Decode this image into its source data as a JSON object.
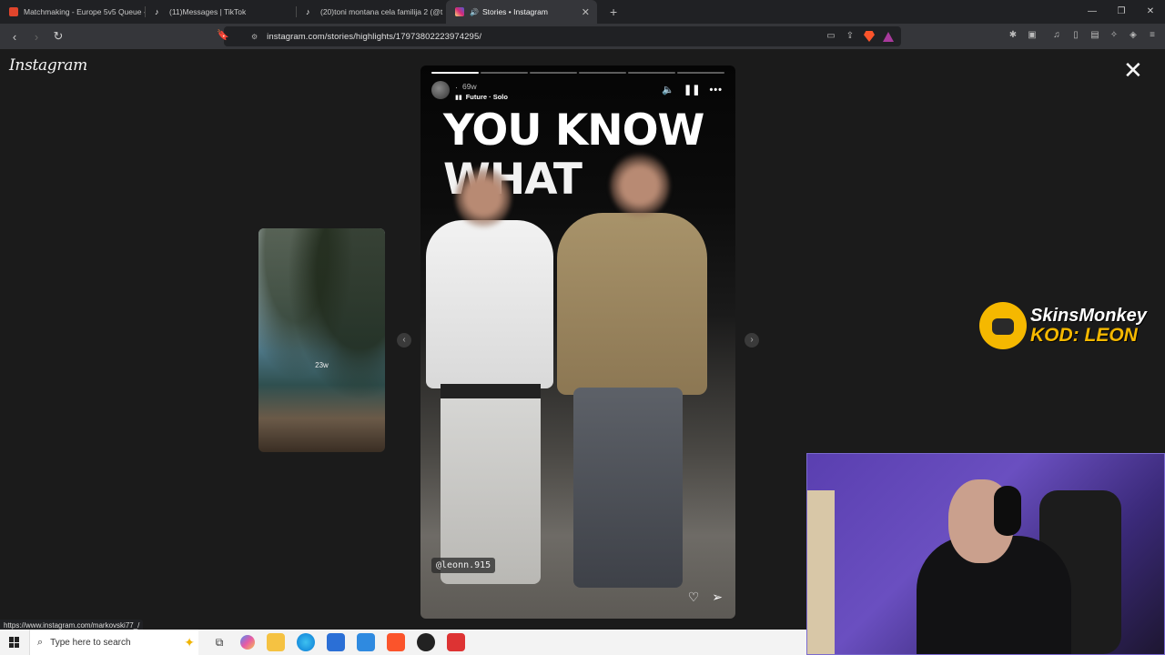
{
  "browser": {
    "tabs": [
      {
        "label": "Matchmaking - Europe 5v5 Queue - ",
        "favicon_color": "#e0452c",
        "active": false
      },
      {
        "label": "(11)Messages | TikTok",
        "favicon_color": "#ffffff",
        "active": false
      },
      {
        "label": "(20)toni montana cela familija 2 (@t",
        "favicon_color": "#ffffff",
        "active": false
      },
      {
        "label": "Stories • Instagram",
        "favicon_color": "#d62976",
        "active": true
      }
    ],
    "new_tab": "+",
    "address_url": "instagram.com/stories/highlights/17973802223974295/",
    "window_controls": {
      "minimize": "—",
      "restore": "❐",
      "close": "✕"
    }
  },
  "instagram": {
    "logo": "Instagram",
    "close": "✕",
    "prev_story_age": "23w",
    "story": {
      "username": "·",
      "age": "69w",
      "music": "Future · Solo",
      "overlay_line1": "YOU KNOW",
      "overlay_line2": "WHAT",
      "tag": "@leonn.915",
      "progress_total": 6,
      "progress_done": 1
    }
  },
  "overlay": {
    "brand": "SkinsMonkey",
    "code": "KOD: LEON"
  },
  "status_bar_url": "https://www.instagram.com/markovski77_/",
  "taskbar": {
    "search_placeholder": "Type here to search"
  }
}
